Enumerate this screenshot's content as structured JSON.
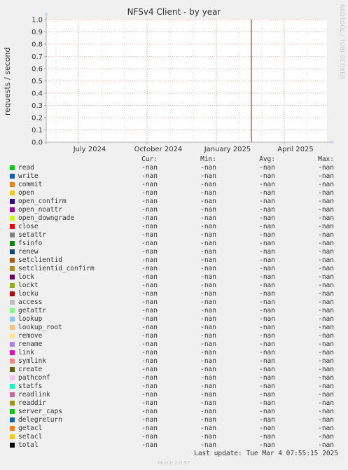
{
  "chart_data": {
    "type": "line",
    "title": "NFSv4 Client - by year",
    "ylabel": "requests / second",
    "ylim": [
      0,
      1.0
    ],
    "yticks": [
      "0.0",
      "0.1",
      "0.2",
      "0.3",
      "0.4",
      "0.5",
      "0.6",
      "0.7",
      "0.8",
      "0.9",
      "1.0"
    ],
    "xticks": [
      "July 2024",
      "October 2024",
      "January 2025",
      "April 2025"
    ],
    "grid": true,
    "series": []
  },
  "side_label": "RRDTOOL / TOBI OETIKER",
  "legend": {
    "headers": {
      "cur": "Cur:",
      "min": "Min:",
      "avg": "Avg:",
      "max": "Max:"
    },
    "rows": [
      {
        "name": "read",
        "color": "#00cc00",
        "cur": "-nan",
        "min": "-nan",
        "avg": "-nan",
        "max": "-nan"
      },
      {
        "name": "write",
        "color": "#0066b3",
        "cur": "-nan",
        "min": "-nan",
        "avg": "-nan",
        "max": "-nan"
      },
      {
        "name": "commit",
        "color": "#ff8000",
        "cur": "-nan",
        "min": "-nan",
        "avg": "-nan",
        "max": "-nan"
      },
      {
        "name": "open",
        "color": "#ffcc00",
        "cur": "-nan",
        "min": "-nan",
        "avg": "-nan",
        "max": "-nan"
      },
      {
        "name": "open_confirm",
        "color": "#330099",
        "cur": "-nan",
        "min": "-nan",
        "avg": "-nan",
        "max": "-nan"
      },
      {
        "name": "open_noattr",
        "color": "#990099",
        "cur": "-nan",
        "min": "-nan",
        "avg": "-nan",
        "max": "-nan"
      },
      {
        "name": "open_downgrade",
        "color": "#ccff00",
        "cur": "-nan",
        "min": "-nan",
        "avg": "-nan",
        "max": "-nan"
      },
      {
        "name": "close",
        "color": "#ff0000",
        "cur": "-nan",
        "min": "-nan",
        "avg": "-nan",
        "max": "-nan"
      },
      {
        "name": "setattr",
        "color": "#808080",
        "cur": "-nan",
        "min": "-nan",
        "avg": "-nan",
        "max": "-nan"
      },
      {
        "name": "fsinfo",
        "color": "#008f00",
        "cur": "-nan",
        "min": "-nan",
        "avg": "-nan",
        "max": "-nan"
      },
      {
        "name": "renew",
        "color": "#00487d",
        "cur": "-nan",
        "min": "-nan",
        "avg": "-nan",
        "max": "-nan"
      },
      {
        "name": "setclientid",
        "color": "#b35a00",
        "cur": "-nan",
        "min": "-nan",
        "avg": "-nan",
        "max": "-nan"
      },
      {
        "name": "setclientid_confirm",
        "color": "#b38f00",
        "cur": "-nan",
        "min": "-nan",
        "avg": "-nan",
        "max": "-nan"
      },
      {
        "name": "lock",
        "color": "#6b006b",
        "cur": "-nan",
        "min": "-nan",
        "avg": "-nan",
        "max": "-nan"
      },
      {
        "name": "lockt",
        "color": "#8fb300",
        "cur": "-nan",
        "min": "-nan",
        "avg": "-nan",
        "max": "-nan"
      },
      {
        "name": "locku",
        "color": "#b30000",
        "cur": "-nan",
        "min": "-nan",
        "avg": "-nan",
        "max": "-nan"
      },
      {
        "name": "access",
        "color": "#bebebe",
        "cur": "-nan",
        "min": "-nan",
        "avg": "-nan",
        "max": "-nan"
      },
      {
        "name": "getattr",
        "color": "#80ff80",
        "cur": "-nan",
        "min": "-nan",
        "avg": "-nan",
        "max": "-nan"
      },
      {
        "name": "lookup",
        "color": "#80c9ff",
        "cur": "-nan",
        "min": "-nan",
        "avg": "-nan",
        "max": "-nan"
      },
      {
        "name": "lookup_root",
        "color": "#ffc080",
        "cur": "-nan",
        "min": "-nan",
        "avg": "-nan",
        "max": "-nan"
      },
      {
        "name": "remove",
        "color": "#ffe680",
        "cur": "-nan",
        "min": "-nan",
        "avg": "-nan",
        "max": "-nan"
      },
      {
        "name": "rename",
        "color": "#aa80ff",
        "cur": "-nan",
        "min": "-nan",
        "avg": "-nan",
        "max": "-nan"
      },
      {
        "name": "link",
        "color": "#ee00cc",
        "cur": "-nan",
        "min": "-nan",
        "avg": "-nan",
        "max": "-nan"
      },
      {
        "name": "symlink",
        "color": "#ff8080",
        "cur": "-nan",
        "min": "-nan",
        "avg": "-nan",
        "max": "-nan"
      },
      {
        "name": "create",
        "color": "#666600",
        "cur": "-nan",
        "min": "-nan",
        "avg": "-nan",
        "max": "-nan"
      },
      {
        "name": "pathconf",
        "color": "#ffbfff",
        "cur": "-nan",
        "min": "-nan",
        "avg": "-nan",
        "max": "-nan"
      },
      {
        "name": "statfs",
        "color": "#00ffcc",
        "cur": "-nan",
        "min": "-nan",
        "avg": "-nan",
        "max": "-nan"
      },
      {
        "name": "readlink",
        "color": "#cc6699",
        "cur": "-nan",
        "min": "-nan",
        "avg": "-nan",
        "max": "-nan"
      },
      {
        "name": "readdir",
        "color": "#999900",
        "cur": "-nan",
        "min": "-nan",
        "avg": "-nan",
        "max": "-nan"
      },
      {
        "name": "server_caps",
        "color": "#00cc00",
        "cur": "-nan",
        "min": "-nan",
        "avg": "-nan",
        "max": "-nan"
      },
      {
        "name": "delegreturn",
        "color": "#0066b3",
        "cur": "-nan",
        "min": "-nan",
        "avg": "-nan",
        "max": "-nan"
      },
      {
        "name": "getacl",
        "color": "#ff8000",
        "cur": "-nan",
        "min": "-nan",
        "avg": "-nan",
        "max": "-nan"
      },
      {
        "name": "setacl",
        "color": "#ffcc00",
        "cur": "-nan",
        "min": "-nan",
        "avg": "-nan",
        "max": "-nan"
      },
      {
        "name": "total",
        "color": "#000000",
        "cur": "-nan",
        "min": "-nan",
        "avg": "-nan",
        "max": "-nan"
      }
    ]
  },
  "last_update": "Last update: Tue Mar  4 07:55:15 2025",
  "munin_version": "Munin 2.0.57"
}
